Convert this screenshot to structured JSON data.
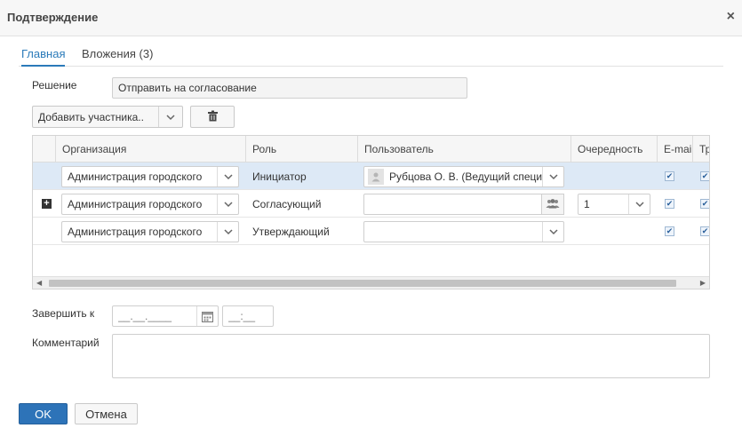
{
  "dialog": {
    "title": "Подтверждение",
    "close_glyph": "×"
  },
  "tabs": [
    {
      "label": "Главная",
      "active": true
    },
    {
      "label": "Вложения (3)",
      "active": false
    }
  ],
  "decision": {
    "label": "Решение",
    "value": "Отправить на согласование"
  },
  "toolbar": {
    "add_participant": "Добавить участника.."
  },
  "grid": {
    "columns": [
      "Организация",
      "Роль",
      "Пользователь",
      "Очередность",
      "E-mail",
      "Тр"
    ],
    "rows": [
      {
        "org": "Администрация городского",
        "role": "Инициатор",
        "user": "Рубцова О. В. (Ведущий специалист)",
        "order": "",
        "email": true,
        "tr": true,
        "selected": true,
        "expand": false
      },
      {
        "org": "Администрация городского",
        "role": "Согласующий",
        "user": "",
        "order": "1",
        "email": true,
        "tr": true,
        "selected": false,
        "expand": true
      },
      {
        "org": "Администрация городского",
        "role": "Утверждающий",
        "user": "",
        "order": "",
        "email": true,
        "tr": true,
        "selected": false,
        "expand": false
      }
    ]
  },
  "deadline": {
    "label": "Завершить к",
    "date_placeholder": "__.__.____",
    "time_placeholder": "__:__"
  },
  "comment": {
    "label": "Комментарий",
    "value": ""
  },
  "footer": {
    "ok": "OK",
    "cancel": "Отмена"
  },
  "colors": {
    "accent": "#2d73b8",
    "selected_row": "#dde9f6"
  }
}
